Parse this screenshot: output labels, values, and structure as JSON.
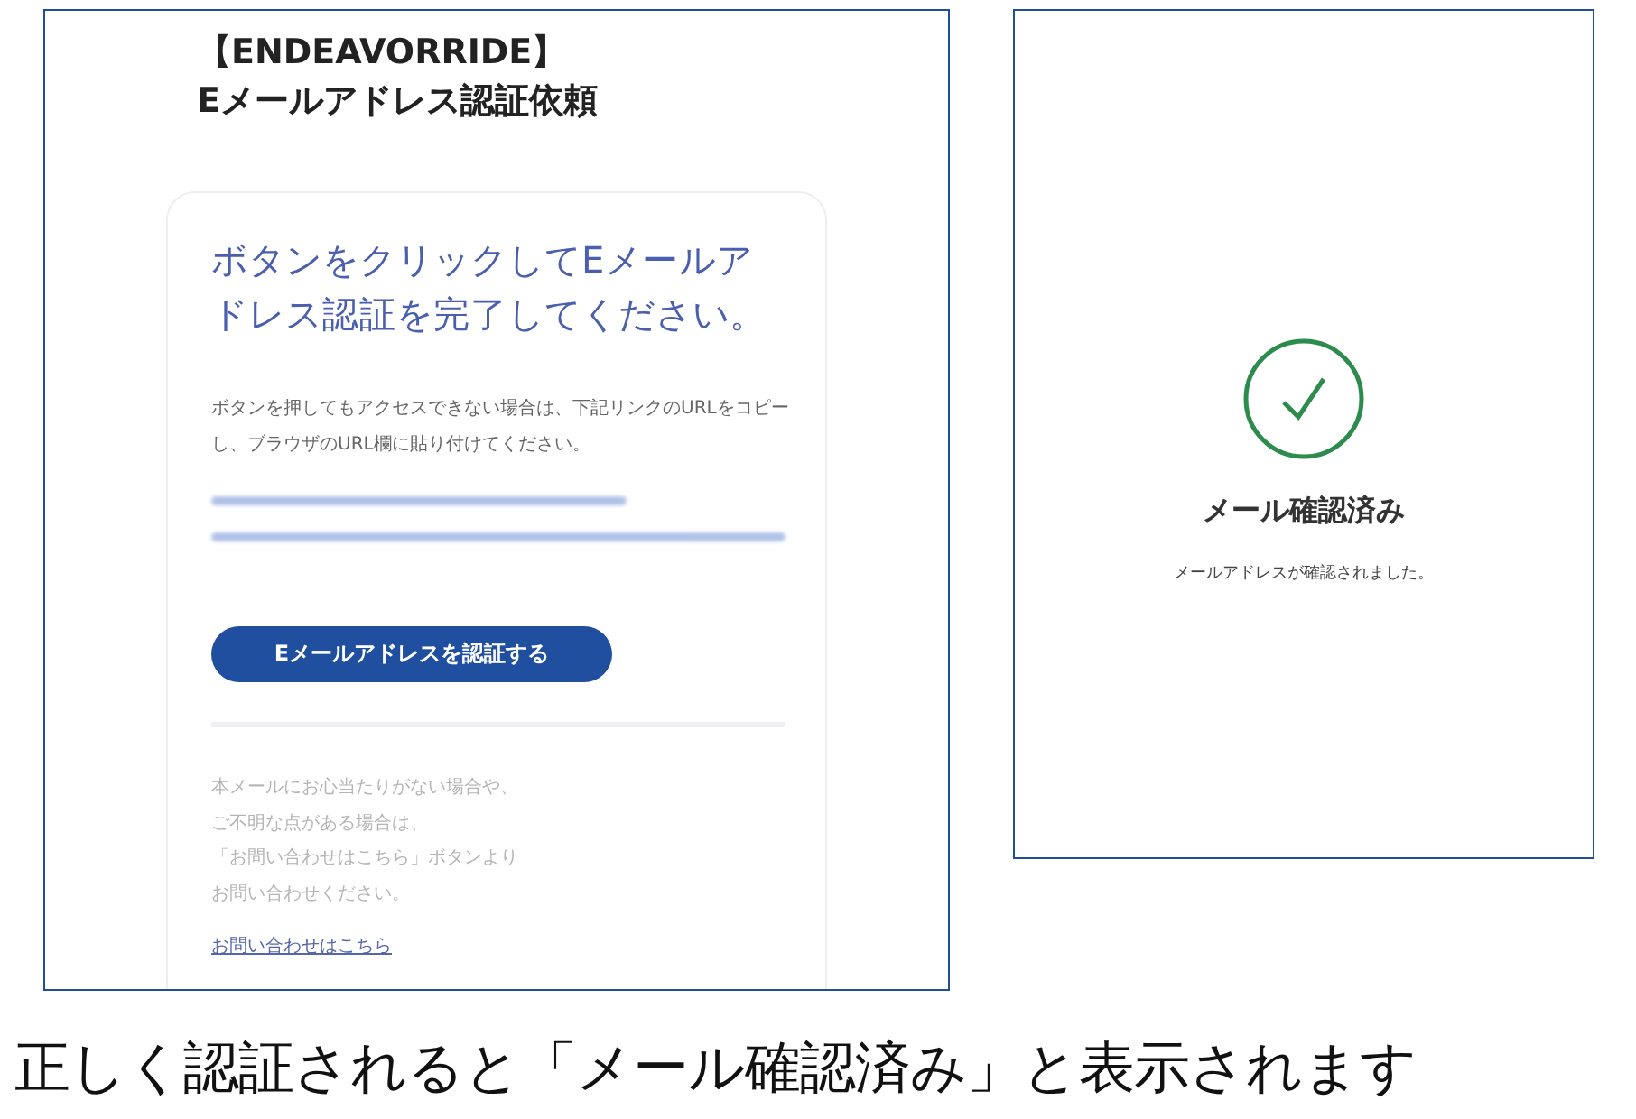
{
  "email_screen": {
    "brand": "【ENDEAVORRIDE】",
    "subject": "Eメールアドレス認証依頼",
    "card": {
      "heading": "ボタンをクリックしてEメールアドレス認証を完了してください。",
      "instructions": "ボタンを押してもアクセスできない場合は、下記リンクのURLをコピーし、ブラウザのURL欄に貼り付けてください。",
      "verify_button": "Eメールアドレスを認証する",
      "notice_lines": [
        "本メールにお心当たりがない場合や、",
        "ご不明な点がある場合は、",
        "「お問い合わせはこちら」ボタンより",
        "お問い合わせください。"
      ],
      "contact_link": "お問い合わせはこちら"
    }
  },
  "confirmed_screen": {
    "title": "メール確認済み",
    "message": "メールアドレスが確認されました。"
  },
  "caption": "正しく認証されると「メール確認済み」と表示されます"
}
